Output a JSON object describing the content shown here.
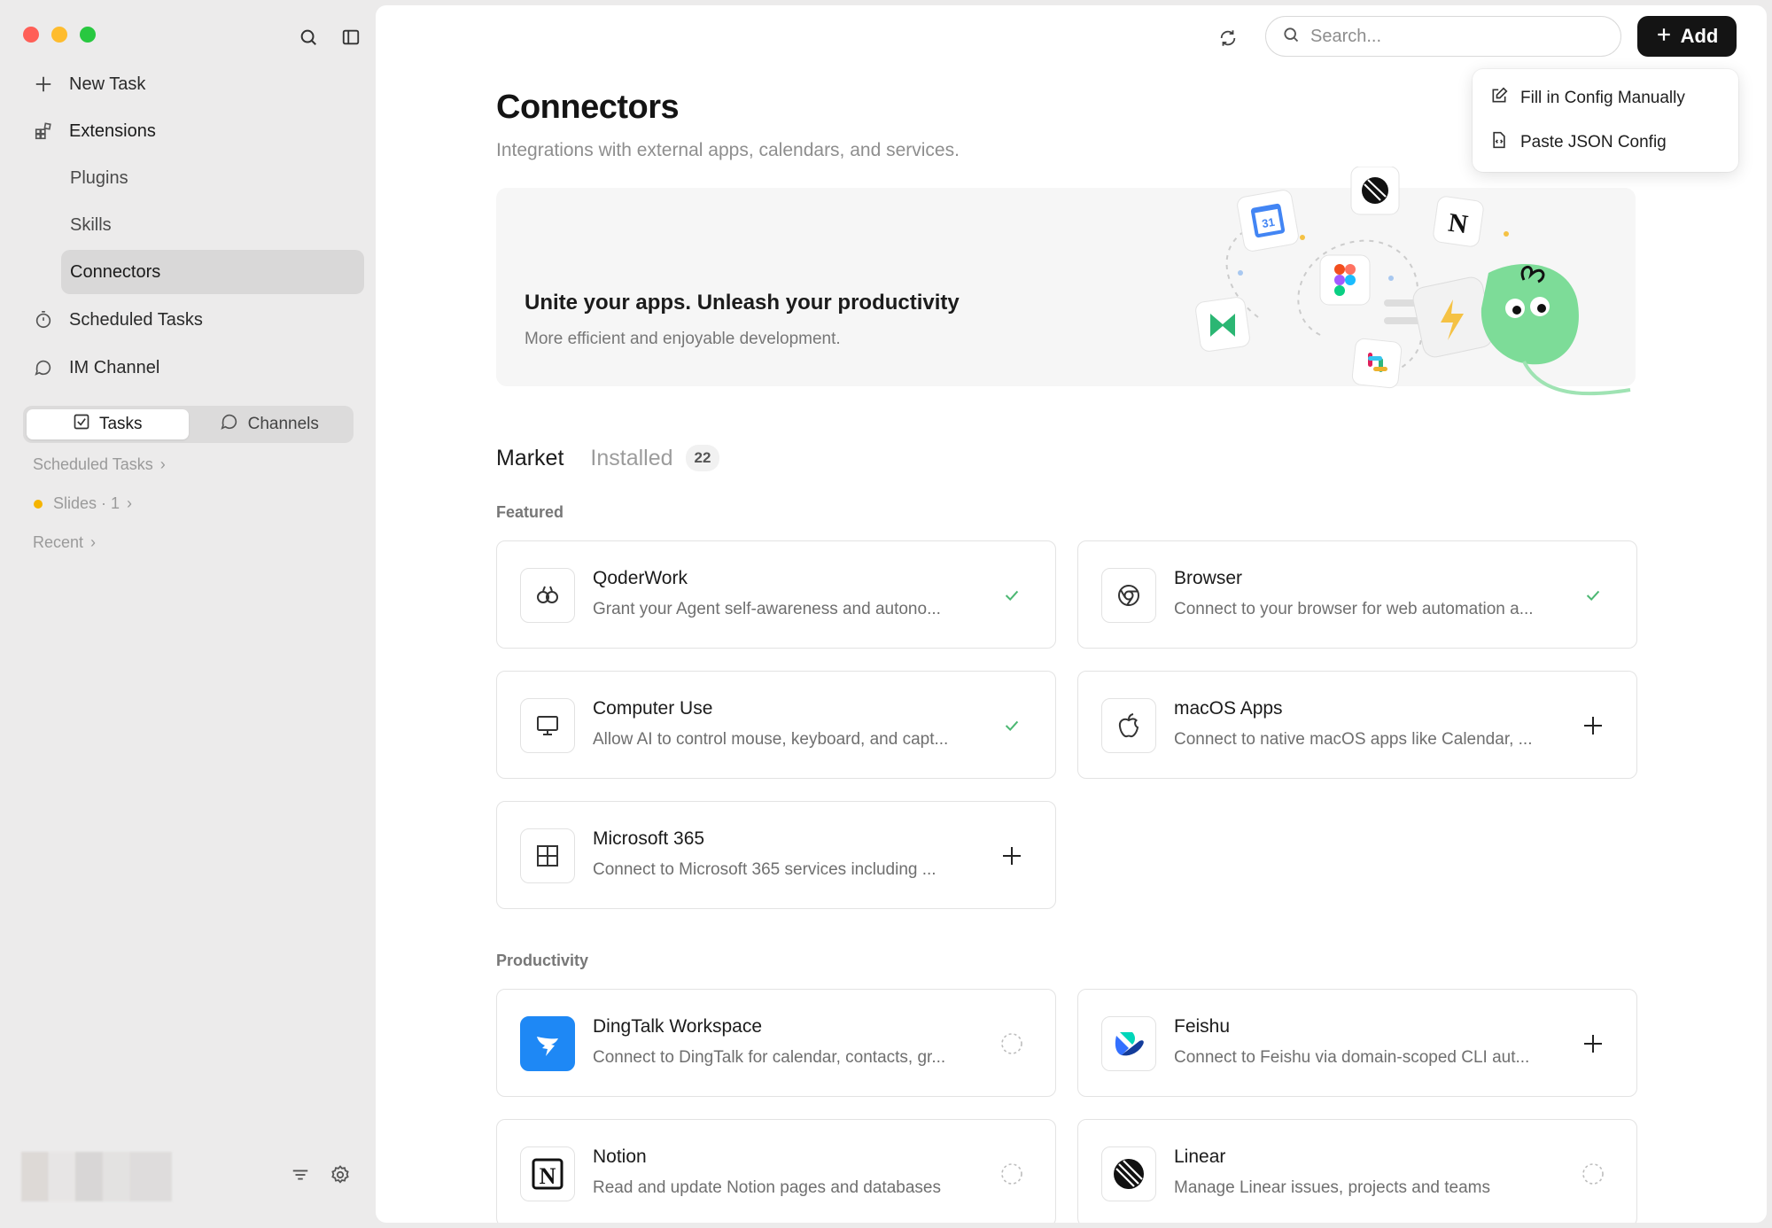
{
  "sidebar": {
    "icons": {
      "search": "search-icon",
      "toggle": "sidebar-toggle-icon"
    },
    "nav": {
      "new_task": "New Task",
      "extensions": "Extensions",
      "plugins": "Plugins",
      "skills": "Skills",
      "connectors": "Connectors",
      "scheduled_tasks": "Scheduled Tasks",
      "im_channel": "IM Channel"
    },
    "segment": {
      "tasks": "Tasks",
      "channels": "Channels",
      "selected": "Tasks"
    },
    "links": {
      "scheduled_tasks": "Scheduled Tasks",
      "slides": "Slides · 1",
      "recent": "Recent"
    },
    "slides_dot_color": "#f5b400"
  },
  "header": {
    "search_placeholder": "Search...",
    "add_label": "Add",
    "dropdown": {
      "fill_manual": "Fill in Config Manually",
      "paste_json": "Paste JSON Config"
    }
  },
  "page": {
    "title": "Connectors",
    "subtitle": "Integrations with external apps, calendars, and services."
  },
  "banner": {
    "title": "Unite your apps. Unleash your productivity",
    "subtitle": "More efficient and enjoyable development."
  },
  "tabs": {
    "market": "Market",
    "installed": "Installed",
    "installed_count": "22",
    "active": "Market"
  },
  "sections": {
    "featured": "Featured",
    "productivity": "Productivity"
  },
  "featured": [
    {
      "name": "QoderWork",
      "desc": "Grant your Agent self-awareness and autono...",
      "icon": "qoderwork-icon",
      "status": "installed"
    },
    {
      "name": "Browser",
      "desc": "Connect to your browser for web automation a...",
      "icon": "chrome-icon",
      "status": "installed"
    },
    {
      "name": "Computer Use",
      "desc": "Allow AI to control mouse, keyboard, and capt...",
      "icon": "monitor-icon",
      "status": "installed"
    },
    {
      "name": "macOS Apps",
      "desc": "Connect to native macOS apps like Calendar, ...",
      "icon": "apple-icon",
      "status": "add"
    },
    {
      "name": "Microsoft 365",
      "desc": "Connect to Microsoft 365 services including ...",
      "icon": "microsoft-icon",
      "status": "add"
    }
  ],
  "productivity": [
    {
      "name": "DingTalk Workspace",
      "desc": "Connect to DingTalk for calendar, contacts, gr...",
      "icon": "dingtalk-icon",
      "status": "pending"
    },
    {
      "name": "Feishu",
      "desc": "Connect to Feishu via domain-scoped CLI aut...",
      "icon": "feishu-icon",
      "status": "add"
    },
    {
      "name": "Notion",
      "desc": "Read and update Notion pages and databases",
      "icon": "notion-icon",
      "status": "pending"
    },
    {
      "name": "Linear",
      "desc": "Manage Linear issues, projects and teams",
      "icon": "linear-icon",
      "status": "pending"
    }
  ],
  "colors": {
    "accent": "#141414",
    "check": "#4cb873",
    "sidebar_bg": "#ecebeb",
    "active_nav": "#d9d8d8"
  }
}
